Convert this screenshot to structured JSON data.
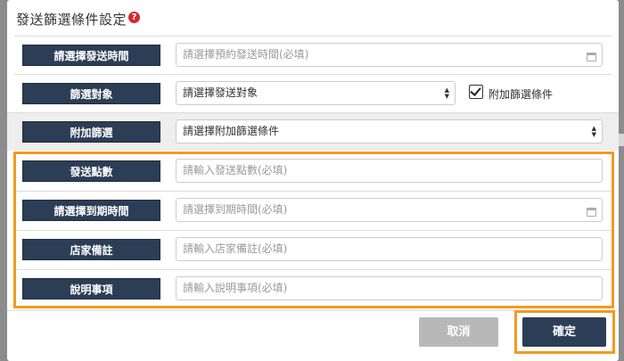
{
  "dialog": {
    "title": "發送篩選條件設定",
    "help_glyph": "?"
  },
  "rows": [
    {
      "label": "請選擇發送時間",
      "placeholder": "請選擇預約發送時間(必填)"
    },
    {
      "label": "篩選對象",
      "value": "請選擇發送對象",
      "checkbox_label": "附加篩選條件",
      "checked": true
    },
    {
      "label": "附加篩選",
      "value": "請選擇附加篩選條件"
    },
    {
      "label": "發送點數",
      "placeholder": "請輸入發送點數(必填)"
    },
    {
      "label": "請選擇到期時間",
      "placeholder": "請選擇到期時間(必填)"
    },
    {
      "label": "店家備註",
      "placeholder": "請輸入店家備註(必填)"
    },
    {
      "label": "說明事項",
      "placeholder": "請輸入說明事項(必填)"
    }
  ],
  "footer": {
    "cancel_label": "取消",
    "confirm_label": "確定"
  },
  "colors": {
    "label_bg": "#2c3e56",
    "highlight": "#f39a1f",
    "help_icon": "#d9272e",
    "cancel_bg": "#b8b8b8"
  },
  "icons": {
    "help": "question-circle-icon",
    "calendar": "calendar-icon",
    "select": "select-arrows-icon",
    "checkbox": "checkmark-icon"
  }
}
